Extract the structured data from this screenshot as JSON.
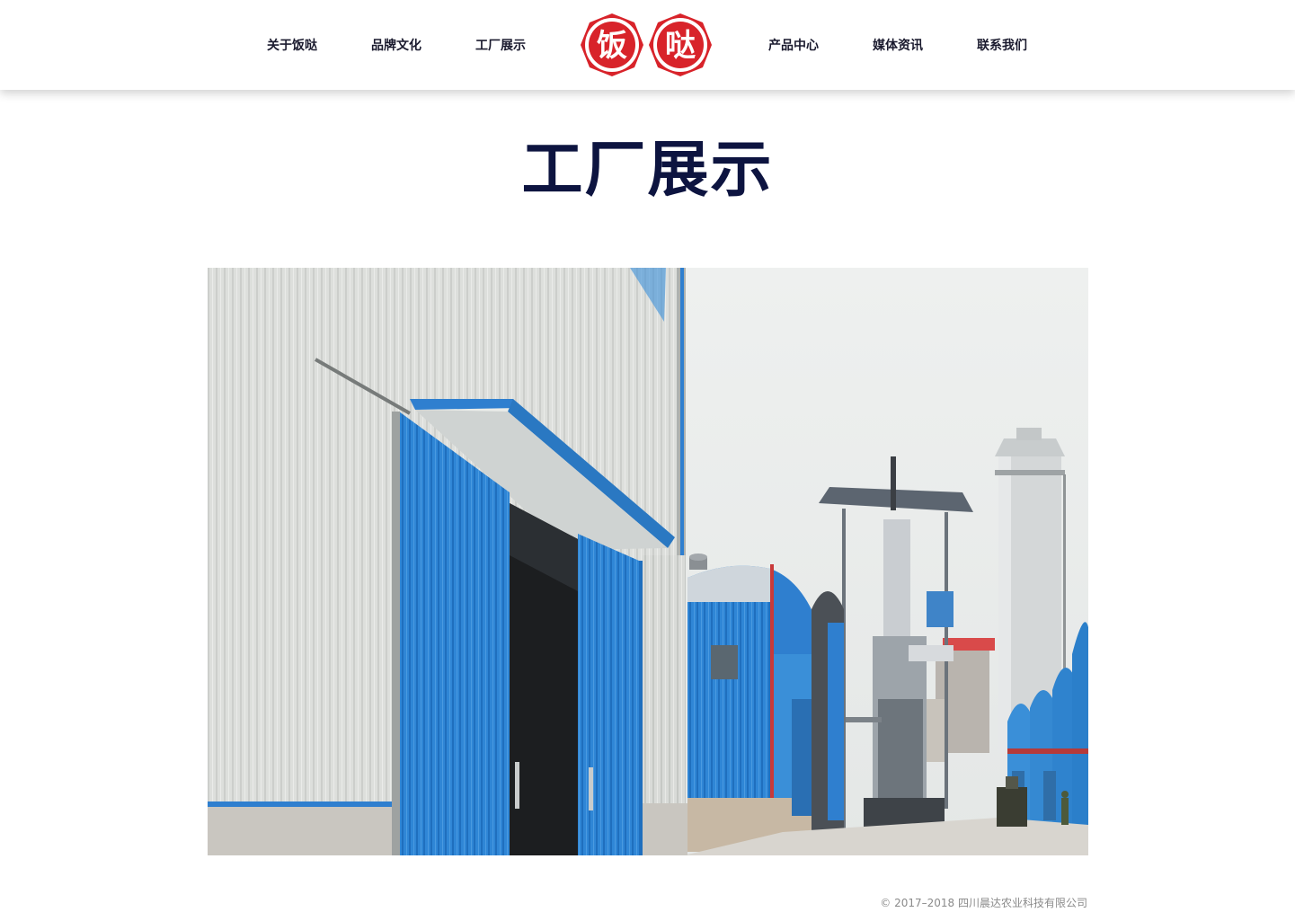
{
  "nav": {
    "left": [
      {
        "label": "关于饭哒"
      },
      {
        "label": "品牌文化"
      },
      {
        "label": "工厂展示"
      }
    ],
    "right": [
      {
        "label": "产品中心"
      },
      {
        "label": "媒体资讯"
      },
      {
        "label": "联系我们"
      }
    ],
    "logo": {
      "char1": "饭",
      "char2": "哒"
    }
  },
  "main": {
    "title": "工厂展示"
  },
  "footer": {
    "copyright": "© 2017–2018 四川晨达农业科技有限公司"
  },
  "colors": {
    "title": "#0d1440",
    "nav_text": "#1a1a2e",
    "logo_red": "#d8232a",
    "factory_blue": "#2a7fcf",
    "footer_text": "#8a8a8a"
  }
}
